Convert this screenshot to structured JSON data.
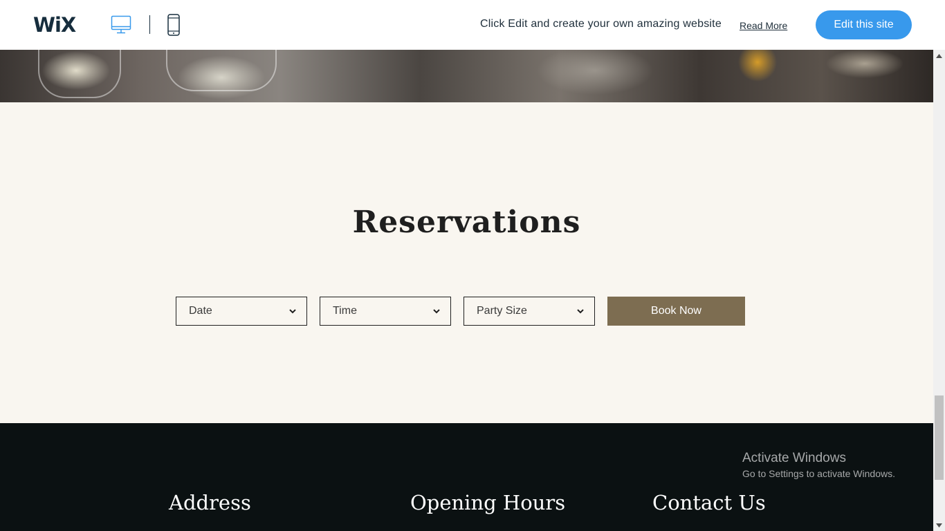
{
  "topbar": {
    "logo": "WiX",
    "promo_text": "Click Edit and create your own amazing website",
    "read_more": "Read More",
    "edit_button": "Edit this site",
    "accent_color": "#3899ec"
  },
  "reservations": {
    "title": "Reservations",
    "date_select": "Date",
    "time_select": "Time",
    "party_select": "Party Size",
    "book_button": "Book Now",
    "button_color": "#7d6d51",
    "background_color": "#f9f6f0"
  },
  "footer": {
    "address_heading": "Address",
    "hours_heading": "Opening Hours",
    "contact_heading": "Contact Us",
    "background_color": "#0b1112"
  },
  "windows_watermark": {
    "title": "Activate Windows",
    "subtitle": "Go to Settings to activate Windows."
  }
}
